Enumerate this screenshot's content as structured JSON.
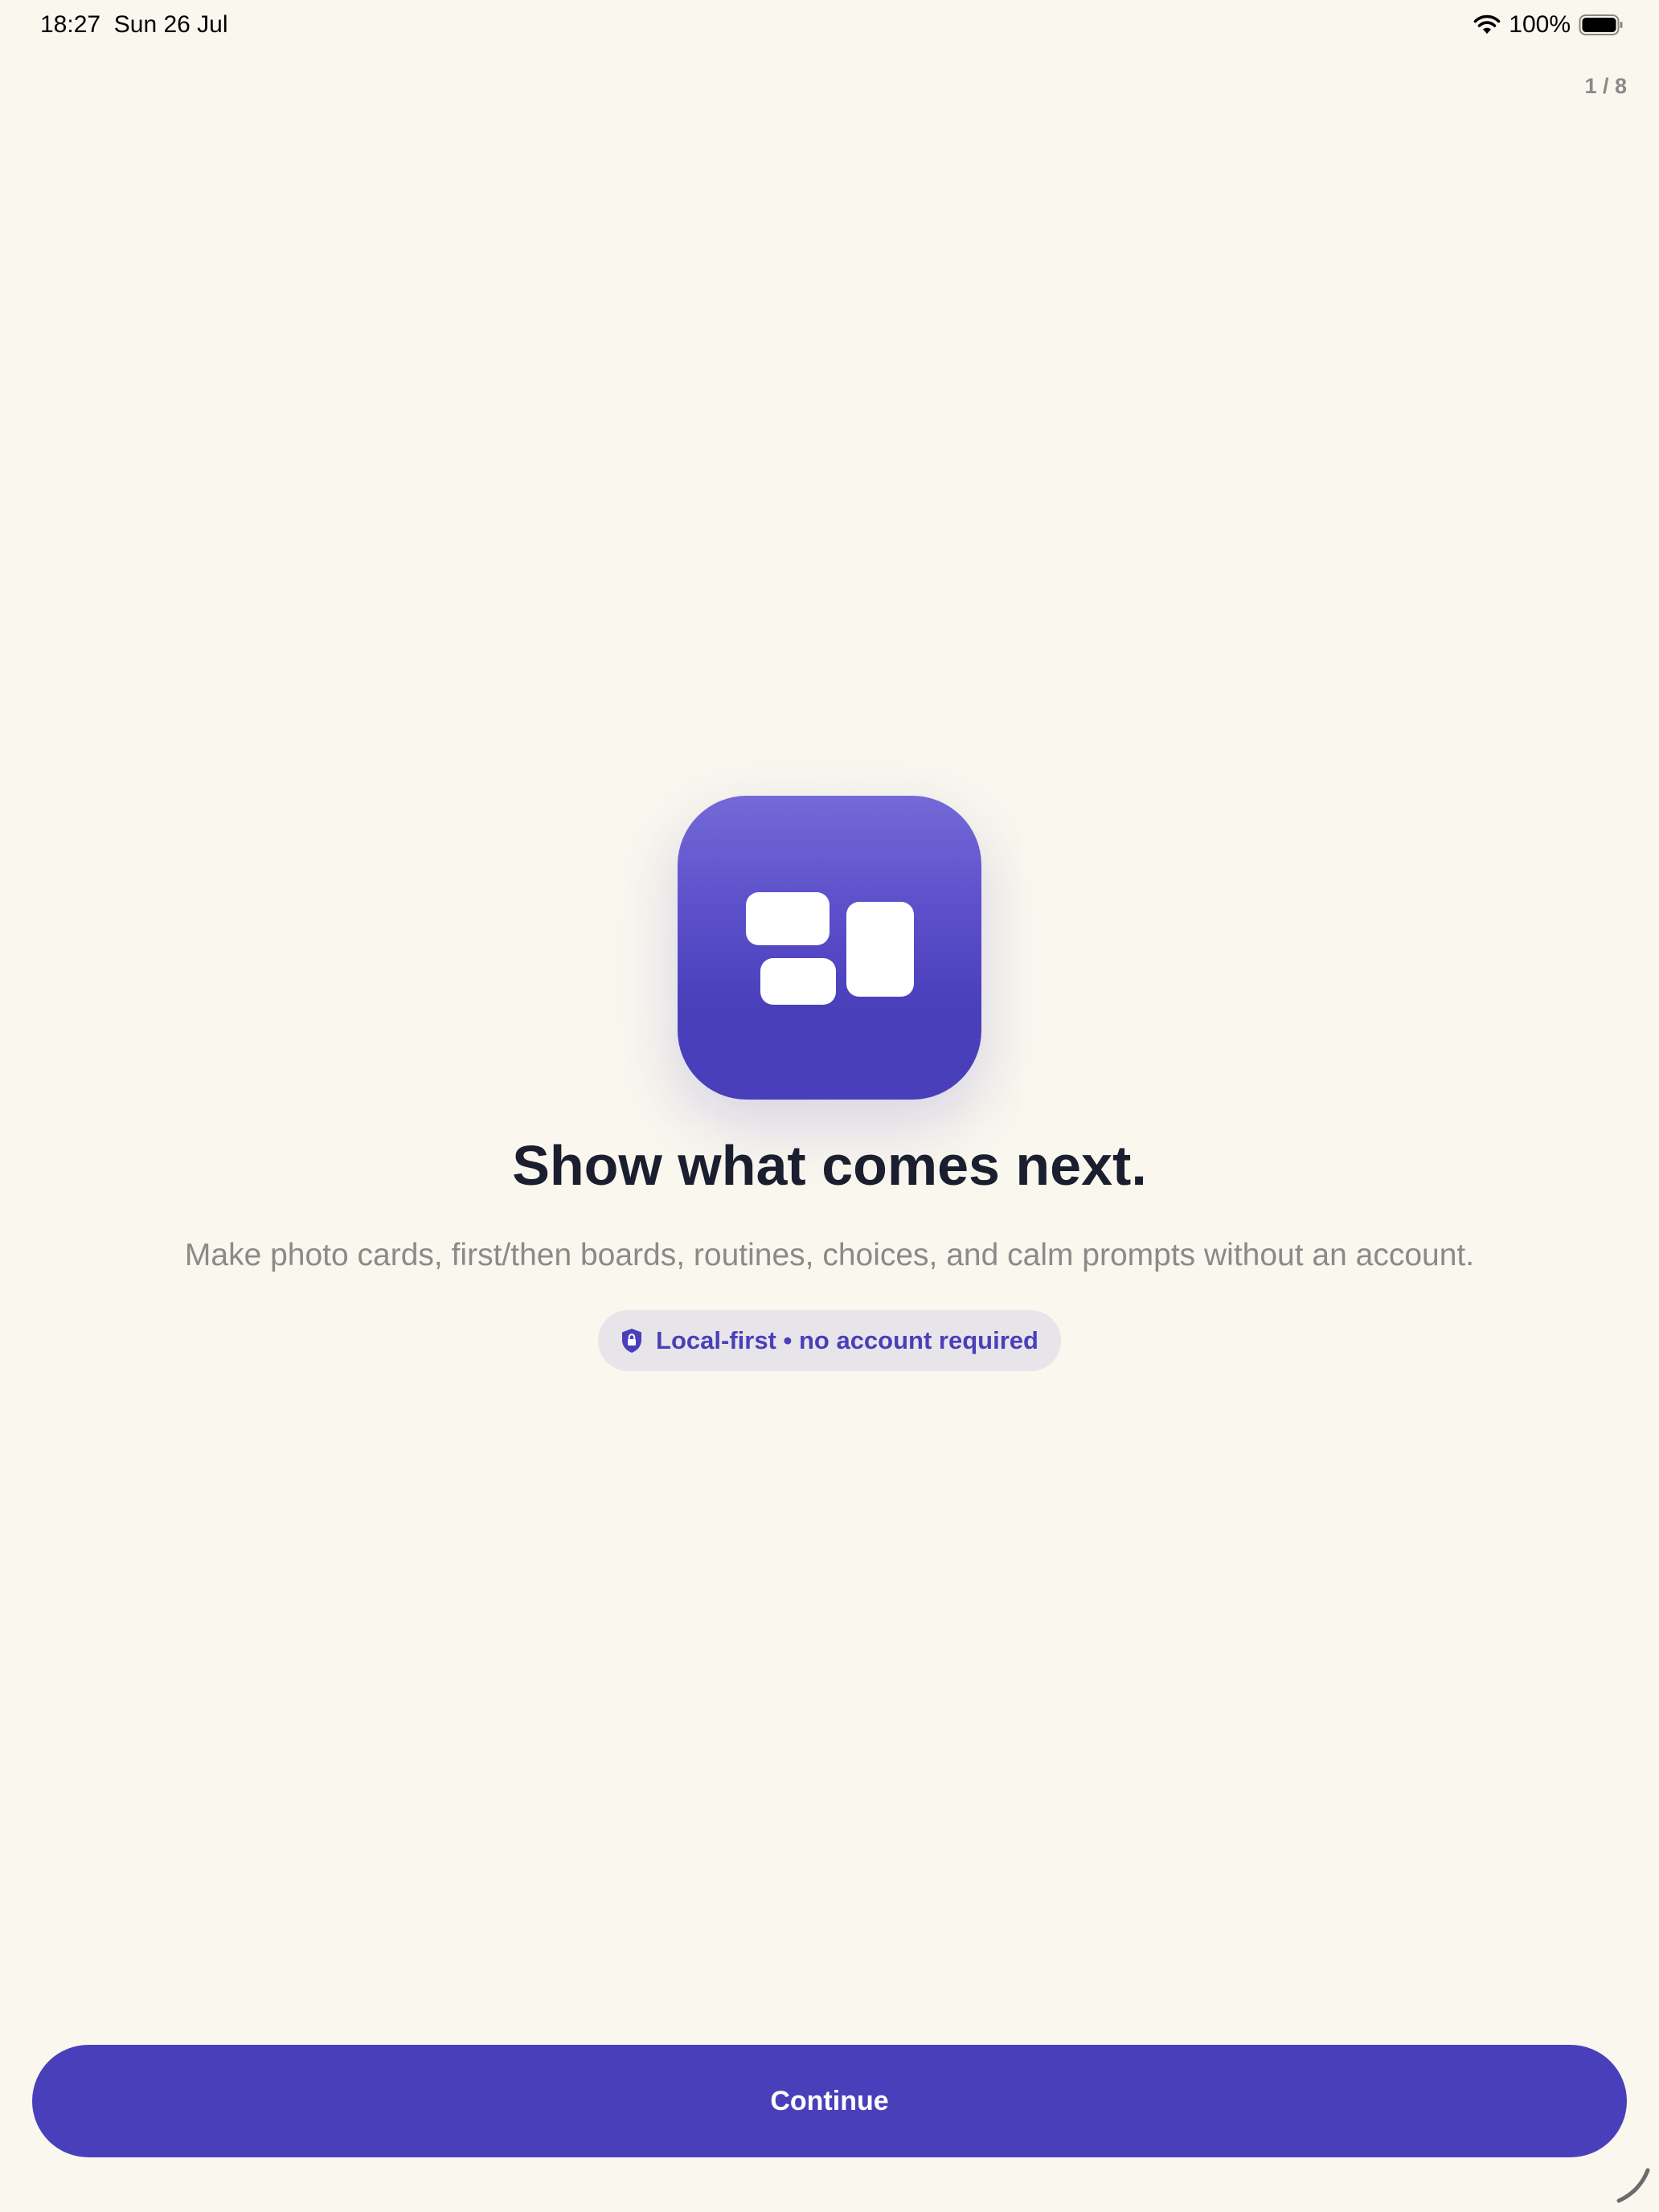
{
  "status_bar": {
    "time": "18:27",
    "date": "Sun 26 Jul",
    "battery": "100%",
    "icons": [
      "wifi-icon",
      "battery-icon"
    ]
  },
  "page_counter": "1 / 8",
  "hero": {
    "icon": "cards-board-icon",
    "headline": "Show what comes next.",
    "subtitle": "Make photo cards, first/then boards, routines, choices, and calm prompts without an account."
  },
  "badge": {
    "icon": "lock-shield-icon",
    "text": "Local-first • no account required"
  },
  "actions": {
    "continue_label": "Continue"
  },
  "colors": {
    "background": "#f9f7ee",
    "accent": "#4a3fbb",
    "headline": "#1a1e2e",
    "muted": "#8a8a88"
  }
}
